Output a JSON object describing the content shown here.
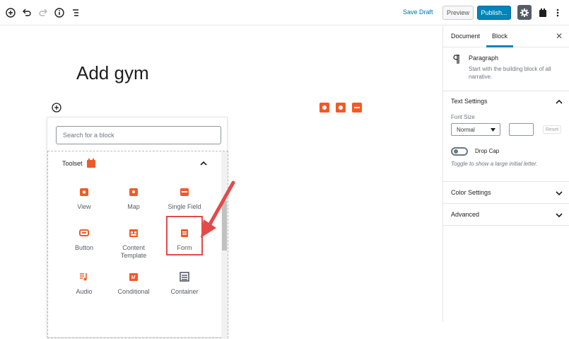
{
  "toolbar": {
    "save_draft": "Save Draft",
    "preview": "Preview",
    "publish": "Publish..."
  },
  "editor": {
    "post_title": "Add gym"
  },
  "inserter": {
    "search_placeholder": "Search for a block",
    "panel_title": "Toolset",
    "blocks": [
      {
        "label": "View",
        "icon": "view-eye-icon"
      },
      {
        "label": "Map",
        "icon": "map-pin-icon"
      },
      {
        "label": "Single Field",
        "icon": "single-field-icon"
      },
      {
        "label": "Button",
        "icon": "button-icon"
      },
      {
        "label": "Content Template",
        "icon": "content-template-icon"
      },
      {
        "label": "Form",
        "icon": "form-icon"
      },
      {
        "label": "Audio",
        "icon": "audio-icon"
      },
      {
        "label": "Conditional",
        "icon": "conditional-icon"
      },
      {
        "label": "Container",
        "icon": "container-icon"
      }
    ]
  },
  "sidebar": {
    "tabs": [
      "Document",
      "Block"
    ],
    "active_tab": "Block",
    "block_card": {
      "title": "Paragraph",
      "description": "Start with the building block of all narrative."
    },
    "text_settings": {
      "title": "Text Settings",
      "font_size_label": "Font Size",
      "font_size_value": "Normal",
      "reset_label": "Reset",
      "drop_cap_label": "Drop Cap",
      "drop_cap_help": "Toggle to show a large initial letter."
    },
    "color_settings": "Color Settings",
    "advanced": "Advanced"
  },
  "colors": {
    "toolset_orange": "#f05a28",
    "publish_blue": "#0085ba",
    "link_blue": "#0073aa",
    "highlight_red": "#e34a4a"
  }
}
